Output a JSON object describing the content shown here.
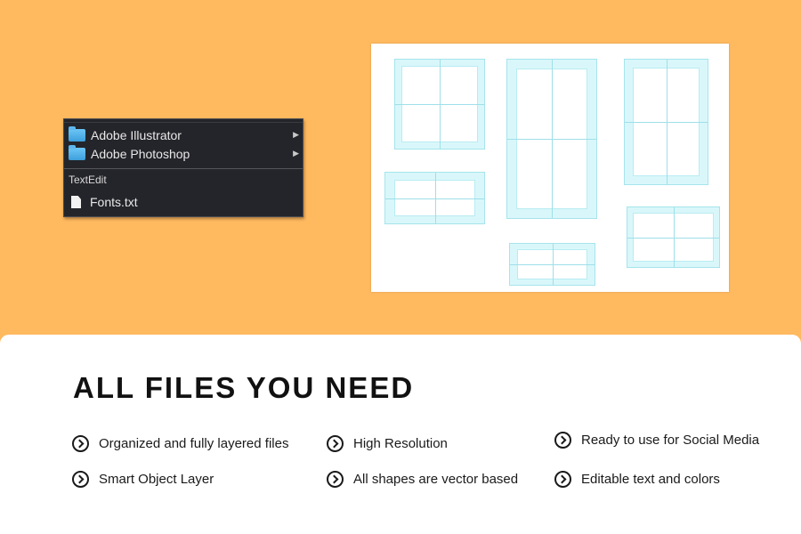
{
  "menu": {
    "items": [
      {
        "label": "Adobe Illustrator",
        "icon": "folder-icon",
        "submenu_arrow": "▶"
      },
      {
        "label": "Adobe Photoshop",
        "icon": "folder-icon",
        "submenu_arrow": "▶"
      }
    ],
    "section_label": "TextEdit",
    "file": {
      "label": "Fonts.txt",
      "icon": "document-icon"
    }
  },
  "colors": {
    "background": "#ffb95f",
    "card": "#ffffff",
    "guide_fill": "#d9f7fa",
    "guide_line": "#9fdfe8",
    "folder": "#4aaee8"
  },
  "headline": "ALL FILES YOU NEED",
  "features": [
    {
      "label": "Organized and fully layered files",
      "icon": "chevron-circle-icon"
    },
    {
      "label": "High Resolution",
      "icon": "chevron-circle-icon"
    },
    {
      "label": "Ready to use for Social Media",
      "icon": "chevron-circle-icon"
    },
    {
      "label": "Smart Object Layer",
      "icon": "chevron-circle-icon"
    },
    {
      "label": "All shapes are vector based",
      "icon": "chevron-circle-icon"
    },
    {
      "label": "Editable text and colors",
      "icon": "chevron-circle-icon"
    }
  ]
}
